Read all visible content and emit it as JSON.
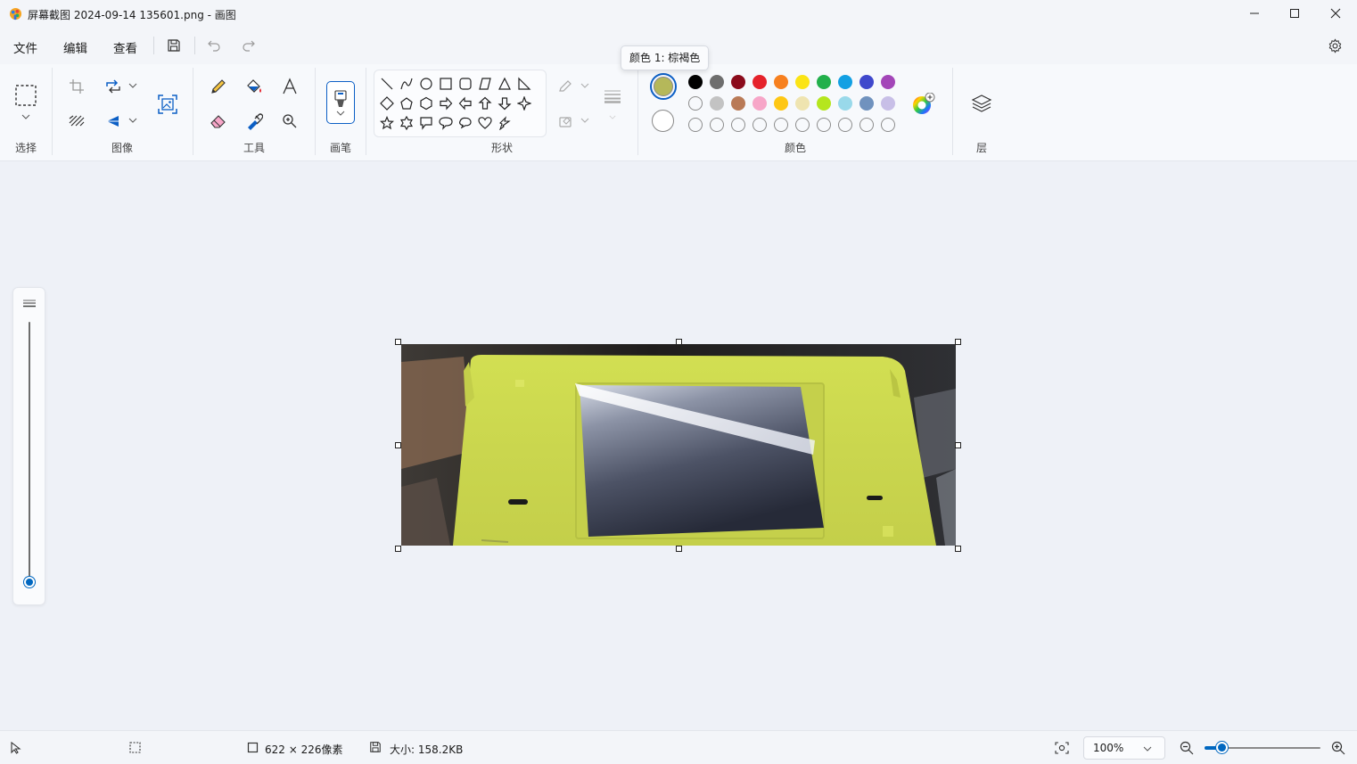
{
  "window": {
    "title": "屏幕截图 2024-09-14 135601.png - 画图",
    "icons": [
      "paint-app-icon",
      "minimize-icon",
      "maximize-icon",
      "close-icon"
    ]
  },
  "menu": {
    "file": "文件",
    "edit": "编辑",
    "view": "查看",
    "icons": [
      "save-icon",
      "undo-icon",
      "redo-icon",
      "settings-icon"
    ]
  },
  "ribbon": {
    "groups": {
      "select": "选择",
      "image": "图像",
      "tools": "工具",
      "brushes": "画笔",
      "shapes": "形状",
      "colors": "颜色",
      "layers": "层"
    },
    "tooltip": "颜色 1: 棕褐色",
    "color1": "#b5b85a",
    "color2": "#ffffff",
    "palette_row1": [
      "#000000",
      "#6e6e6e",
      "#8b0b1c",
      "#e5222b",
      "#f7801f",
      "#fbe415",
      "#22b04b",
      "#12a0e3",
      "#3f48cc",
      "#a346b8"
    ],
    "palette_row2": [
      "#ffffff",
      "#c3c3c3",
      "#b97a57",
      "#f7a6c8",
      "#fec714",
      "#efe4b0",
      "#b5e61d",
      "#99d9ea",
      "#7092be",
      "#c8bfe7"
    ],
    "custom_slots": 10
  },
  "status": {
    "dimensions": "622 × 226像素",
    "size": "大小: 158.2KB",
    "zoom": "100%",
    "zoom_level_fraction": 0.15
  }
}
